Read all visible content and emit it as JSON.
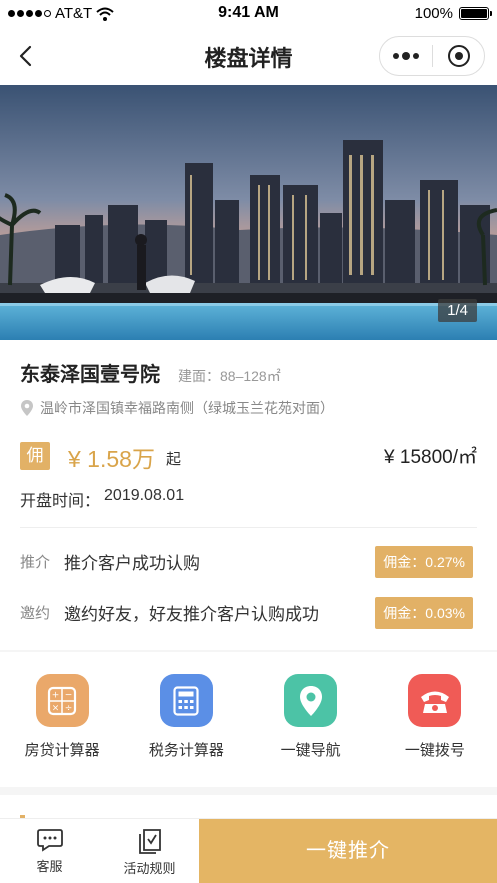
{
  "status_bar": {
    "carrier": "AT&T",
    "time": "9:41 AM",
    "battery": "100%",
    "battery_level": 1.0
  },
  "nav": {
    "title": "楼盘详情"
  },
  "hero": {
    "counter": "1/4"
  },
  "property": {
    "name": "东泰泽国壹号院",
    "area": "建面：88–128㎡",
    "address": "温岭市泽国镇幸福路南侧（绿城玉兰花苑对面）",
    "commission_badge": "佣",
    "price_total": "¥ 1.58万",
    "price_from": "起",
    "price_unit": "¥ 15800/㎡",
    "open_label": "开盘时间：",
    "open_date": "2019.08.01"
  },
  "rewards": [
    {
      "tag": "推介",
      "desc": "推介客户成功认购",
      "pill": "佣金：0.27%"
    },
    {
      "tag": "邀约",
      "desc": "邀约好友，好友推介客户认购成功",
      "pill": "佣金：0.03%"
    }
  ],
  "tools": [
    {
      "label": "房贷计算器",
      "icon": "calculator-icon",
      "color": "#e9a867"
    },
    {
      "label": "税务计算器",
      "icon": "tax-calculator-icon",
      "color": "#5b8fe6"
    },
    {
      "label": "一键导航",
      "icon": "location-pin-icon",
      "color": "#4cc3a6"
    },
    {
      "label": "一键拨号",
      "icon": "phone-icon",
      "color": "#f05b56"
    }
  ],
  "bottom_bar": {
    "service_label": "客服",
    "rules_label": "活动规则",
    "cta_label": "一键推介"
  },
  "colors": {
    "accent": "#e2b166",
    "price": "#d9a44a"
  }
}
